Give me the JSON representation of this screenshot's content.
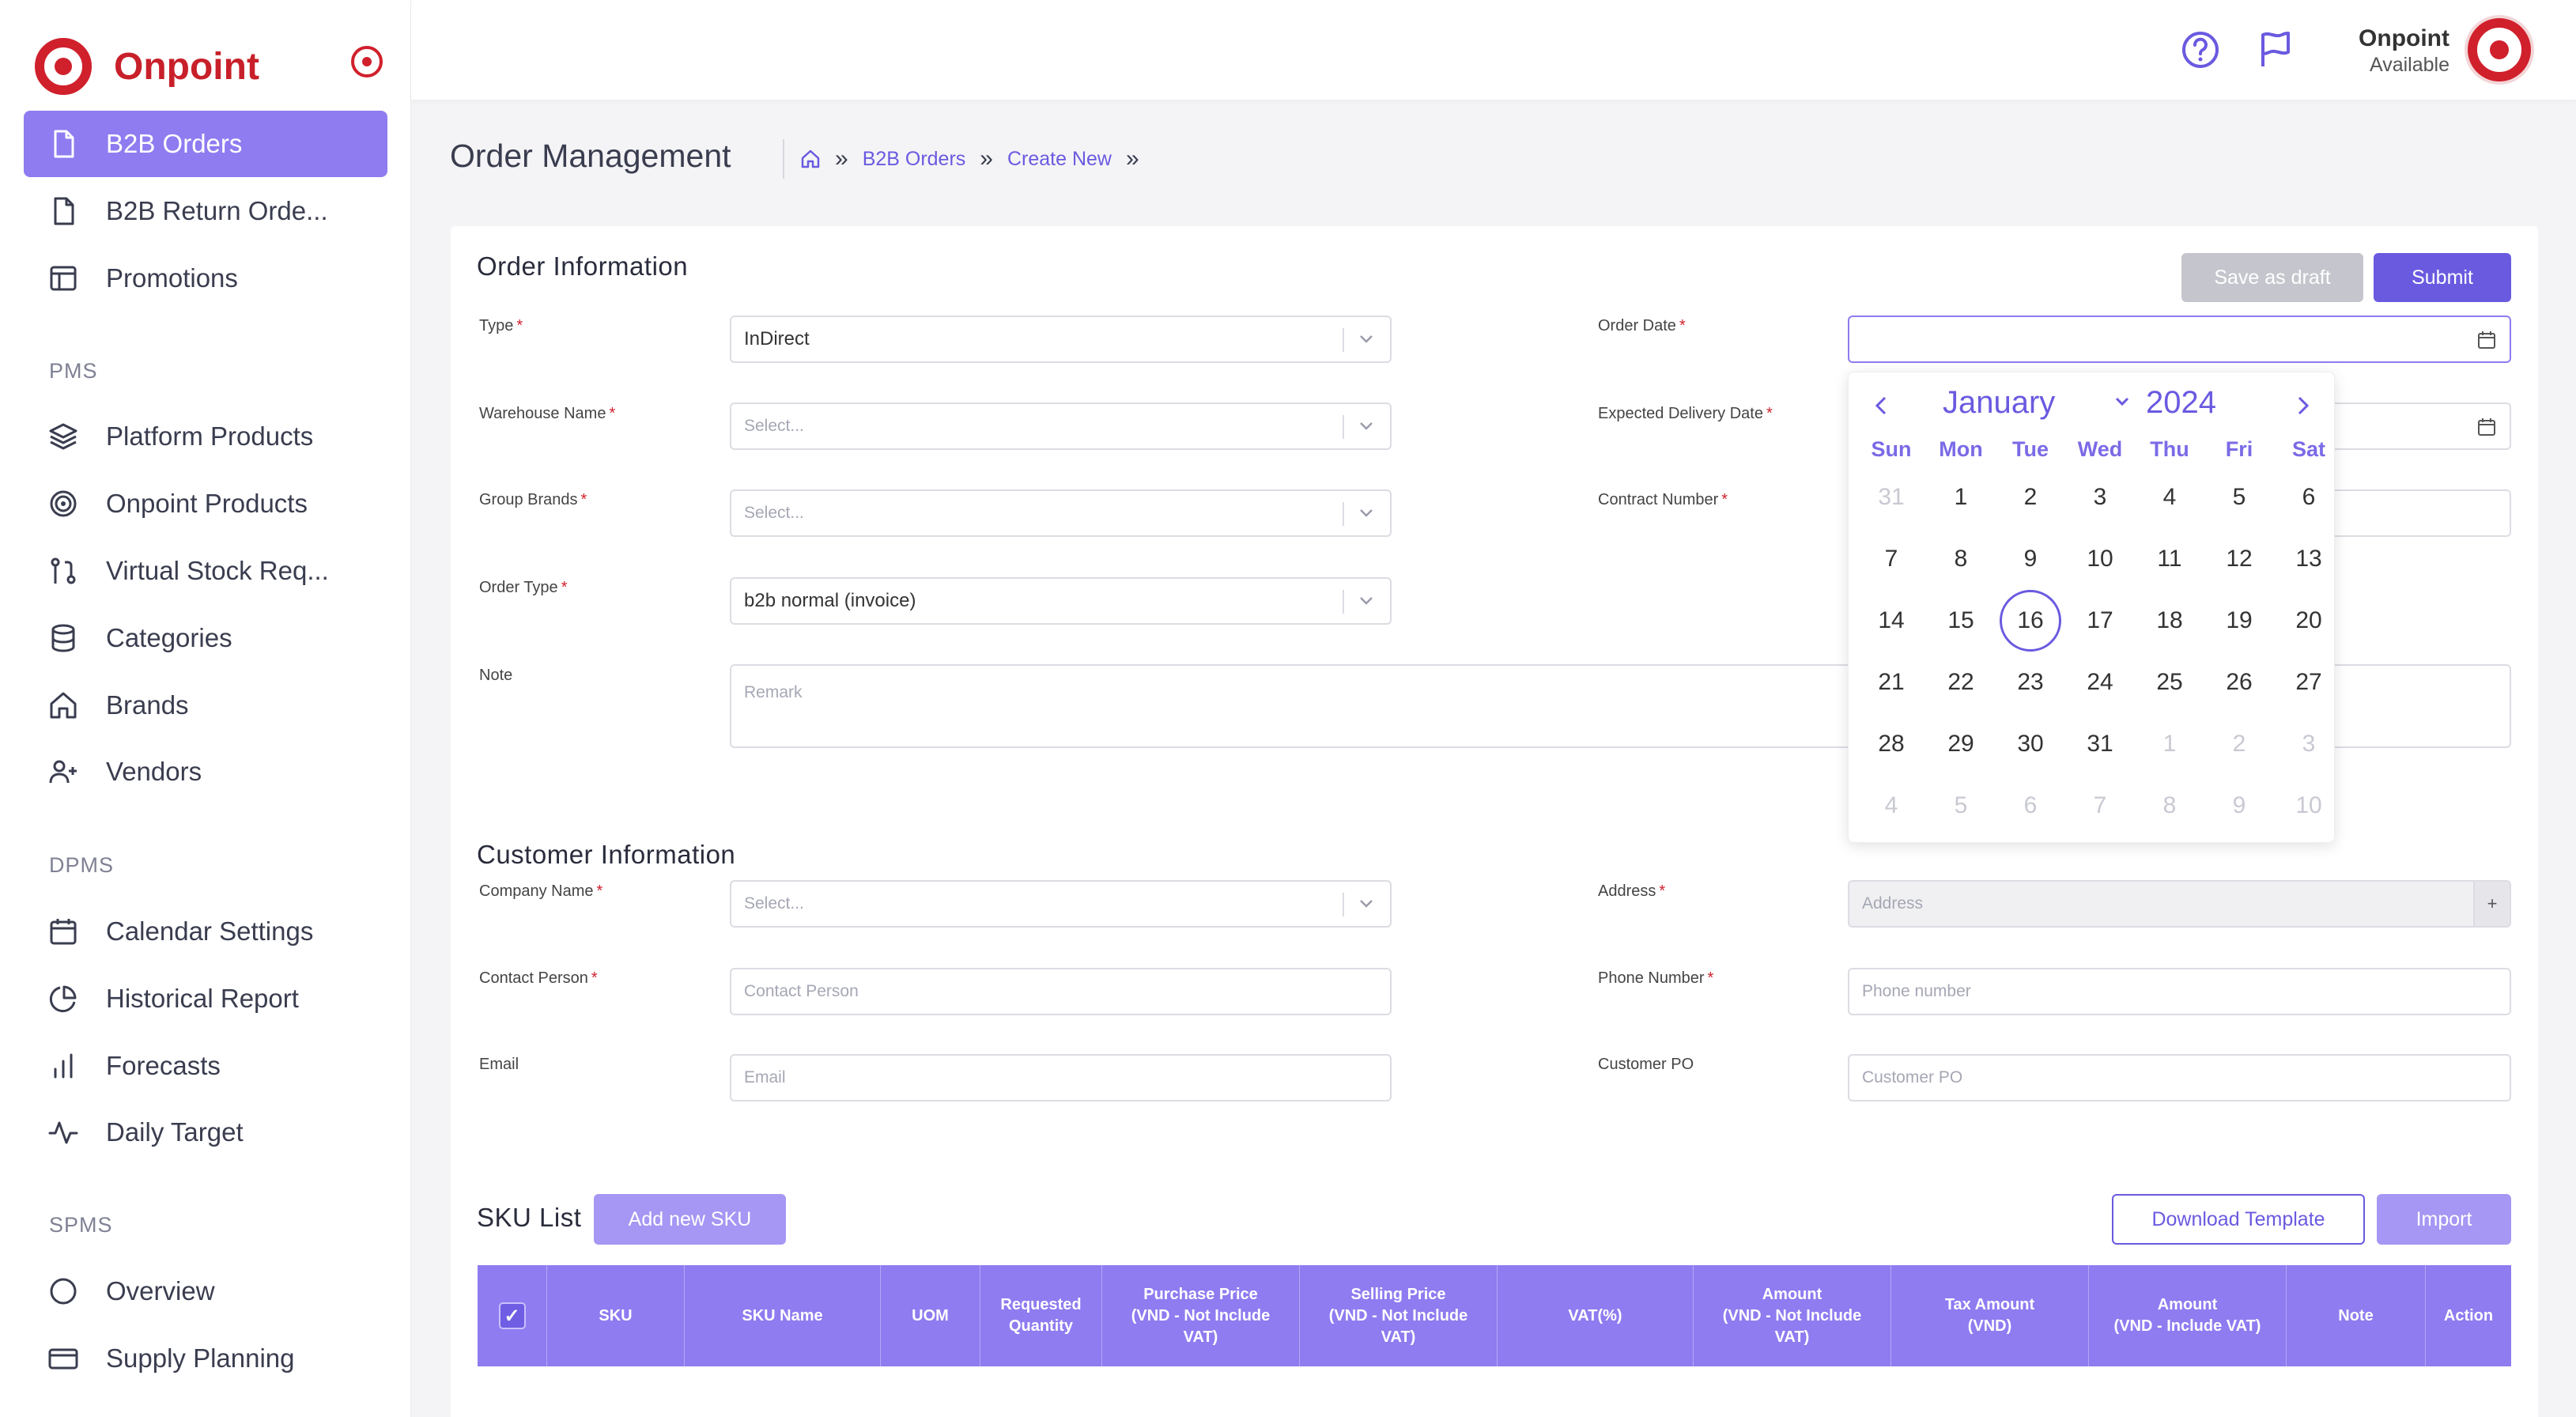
{
  "app": {
    "name": "Onpoint"
  },
  "sidebar": {
    "top_items": [
      {
        "label": "B2B Orders",
        "icon": "document-icon",
        "active": true
      },
      {
        "label": "B2B Return Orde...",
        "icon": "document-icon"
      },
      {
        "label": "Promotions",
        "icon": "layout-icon"
      }
    ],
    "sections": [
      {
        "title": "PMS",
        "items": [
          {
            "label": "Platform Products",
            "icon": "layers-icon"
          },
          {
            "label": "Onpoint Products",
            "icon": "target-icon"
          },
          {
            "label": "Virtual Stock Req...",
            "icon": "git-pull-icon"
          },
          {
            "label": "Categories",
            "icon": "database-icon"
          },
          {
            "label": "Brands",
            "icon": "home-icon"
          },
          {
            "label": "Vendors",
            "icon": "user-plus-icon"
          }
        ]
      },
      {
        "title": "DPMS",
        "items": [
          {
            "label": "Calendar Settings",
            "icon": "calendar-icon"
          },
          {
            "label": "Historical Report",
            "icon": "pie-chart-icon"
          },
          {
            "label": "Forecasts",
            "icon": "bar-chart-icon"
          },
          {
            "label": "Daily Target",
            "icon": "activity-icon"
          }
        ]
      },
      {
        "title": "SPMS",
        "items": [
          {
            "label": "Overview",
            "icon": "circle-icon"
          },
          {
            "label": "Supply Planning",
            "icon": "credit-card-icon"
          }
        ]
      }
    ]
  },
  "topbar": {
    "user_name": "Onpoint",
    "user_status": "Available",
    "icons": [
      "help-circle-icon",
      "flag-icon"
    ]
  },
  "page": {
    "title": "Order Management",
    "breadcrumb": [
      "B2B Orders",
      "Create New"
    ]
  },
  "order_info": {
    "title": "Order Information",
    "save_draft_label": "Save as draft",
    "submit_label": "Submit",
    "type_label": "Type",
    "type_value": "InDirect",
    "warehouse_label": "Warehouse Name",
    "warehouse_placeholder": "Select...",
    "group_brands_label": "Group Brands",
    "group_brands_placeholder": "Select...",
    "order_type_label": "Order Type",
    "order_type_value": "b2b normal (invoice)",
    "note_label": "Note",
    "note_placeholder": "Remark",
    "order_date_label": "Order Date",
    "order_date_value": "",
    "expected_delivery_label": "Expected Delivery Date",
    "contract_number_label": "Contract Number"
  },
  "customer_info": {
    "title": "Customer Information",
    "company_label": "Company Name",
    "company_placeholder": "Select...",
    "contact_label": "Contact Person",
    "contact_placeholder": "Contact Person",
    "email_label": "Email",
    "email_placeholder": "Email",
    "address_label": "Address",
    "address_placeholder": "Address",
    "address_add": "+",
    "phone_label": "Phone Number",
    "phone_placeholder": "Phone number",
    "po_label": "Customer PO",
    "po_placeholder": "Customer PO"
  },
  "sku": {
    "title": "SKU List",
    "add_label": "Add new SKU",
    "download_label": "Download Template",
    "import_label": "Import",
    "columns": [
      "SKU",
      "SKU Name",
      "UOM",
      "Requested\nQuantity",
      "Purchase Price\n(VND - Not Include\nVAT)",
      "Selling Price\n(VND - Not Include\nVAT)",
      "VAT(%)",
      "Amount\n(VND - Not Include\nVAT)",
      "Tax Amount\n(VND)",
      "Amount\n(VND - Include VAT)",
      "Note",
      "Action"
    ]
  },
  "calendar": {
    "month": "January",
    "year": "2024",
    "weekdays": [
      "Sun",
      "Mon",
      "Tue",
      "Wed",
      "Thu",
      "Fri",
      "Sat"
    ],
    "weeks": [
      [
        "31",
        "1",
        "2",
        "3",
        "4",
        "5",
        "6"
      ],
      [
        "7",
        "8",
        "9",
        "10",
        "11",
        "12",
        "13"
      ],
      [
        "14",
        "15",
        "16",
        "17",
        "18",
        "19",
        "20"
      ],
      [
        "21",
        "22",
        "23",
        "24",
        "25",
        "26",
        "27"
      ],
      [
        "28",
        "29",
        "30",
        "31",
        "1",
        "2",
        "3"
      ],
      [
        "4",
        "5",
        "6",
        "7",
        "8",
        "9",
        "10"
      ]
    ],
    "today": "16"
  },
  "colors": {
    "brand": "#d0202c",
    "accent": "#8e7cf0",
    "link": "#6a5ae0"
  }
}
